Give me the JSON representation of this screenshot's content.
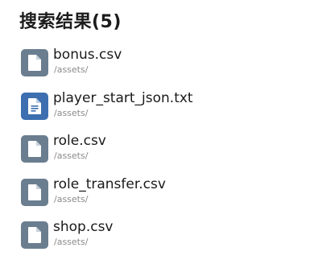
{
  "header": {
    "title": "搜索结果(5)"
  },
  "results": [
    {
      "name": "bonus.csv",
      "path": "/assets/",
      "icon": "file-icon",
      "icon_color": "#6a7e90"
    },
    {
      "name": "player_start_json.txt",
      "path": "/assets/",
      "icon": "text-file-icon",
      "icon_color": "#3d6fb0"
    },
    {
      "name": "role.csv",
      "path": "/assets/",
      "icon": "file-icon",
      "icon_color": "#6a7e90"
    },
    {
      "name": "role_transfer.csv",
      "path": "/assets/",
      "icon": "file-icon",
      "icon_color": "#6a7e90"
    },
    {
      "name": "shop.csv",
      "path": "/assets/",
      "icon": "file-icon",
      "icon_color": "#6a7e90"
    }
  ]
}
